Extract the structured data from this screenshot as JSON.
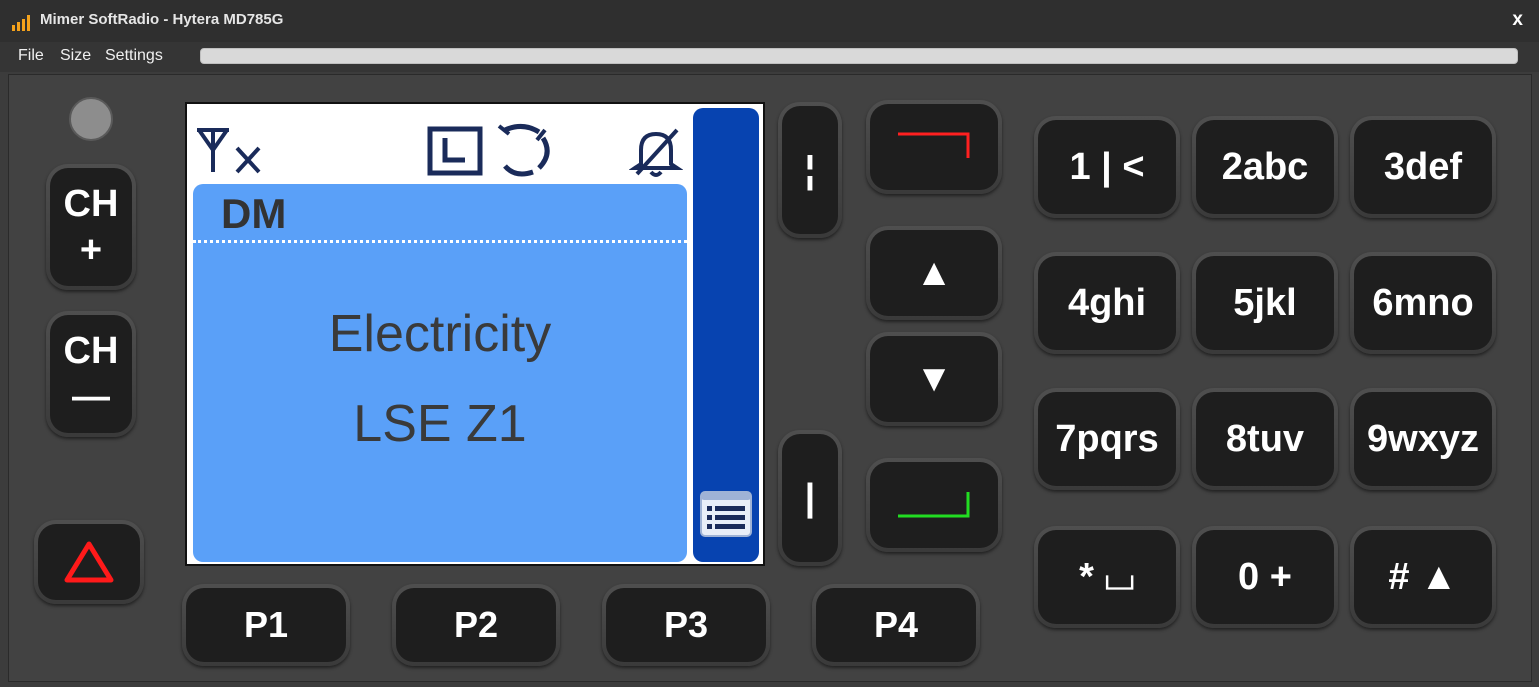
{
  "window": {
    "title": "Mimer SoftRadio - Hytera MD785G",
    "close_label": "x"
  },
  "menu": {
    "items": [
      "File",
      "Size",
      "Settings"
    ]
  },
  "progress": {
    "value_percent": 0
  },
  "display": {
    "mode": "DM",
    "zone": "Electricity",
    "channel": "LSE Z1",
    "screen_color": "#5aa0f8",
    "strip_color": "#0743b0"
  },
  "keys": {
    "ch_up": {
      "line1": "CH",
      "line2": "+"
    },
    "ch_down": {
      "line1": "CH",
      "line2": "—"
    },
    "programmable": [
      "P1",
      "P2",
      "P3",
      "P4"
    ],
    "side_top": "¦",
    "side_bottom": "|",
    "keypad": [
      "1 | <",
      "2abc",
      "3def",
      "4ghi",
      "5jkl",
      "6mno",
      "7pqrs",
      "8tuv",
      "9wxyz",
      "* ⌴",
      "0 +",
      "# ▲"
    ],
    "up_arrow": "▲",
    "down_arrow": "▼"
  },
  "colors": {
    "end_call": "#ff2020",
    "start_call": "#22dd22",
    "emergency": "#ff1a1a"
  }
}
